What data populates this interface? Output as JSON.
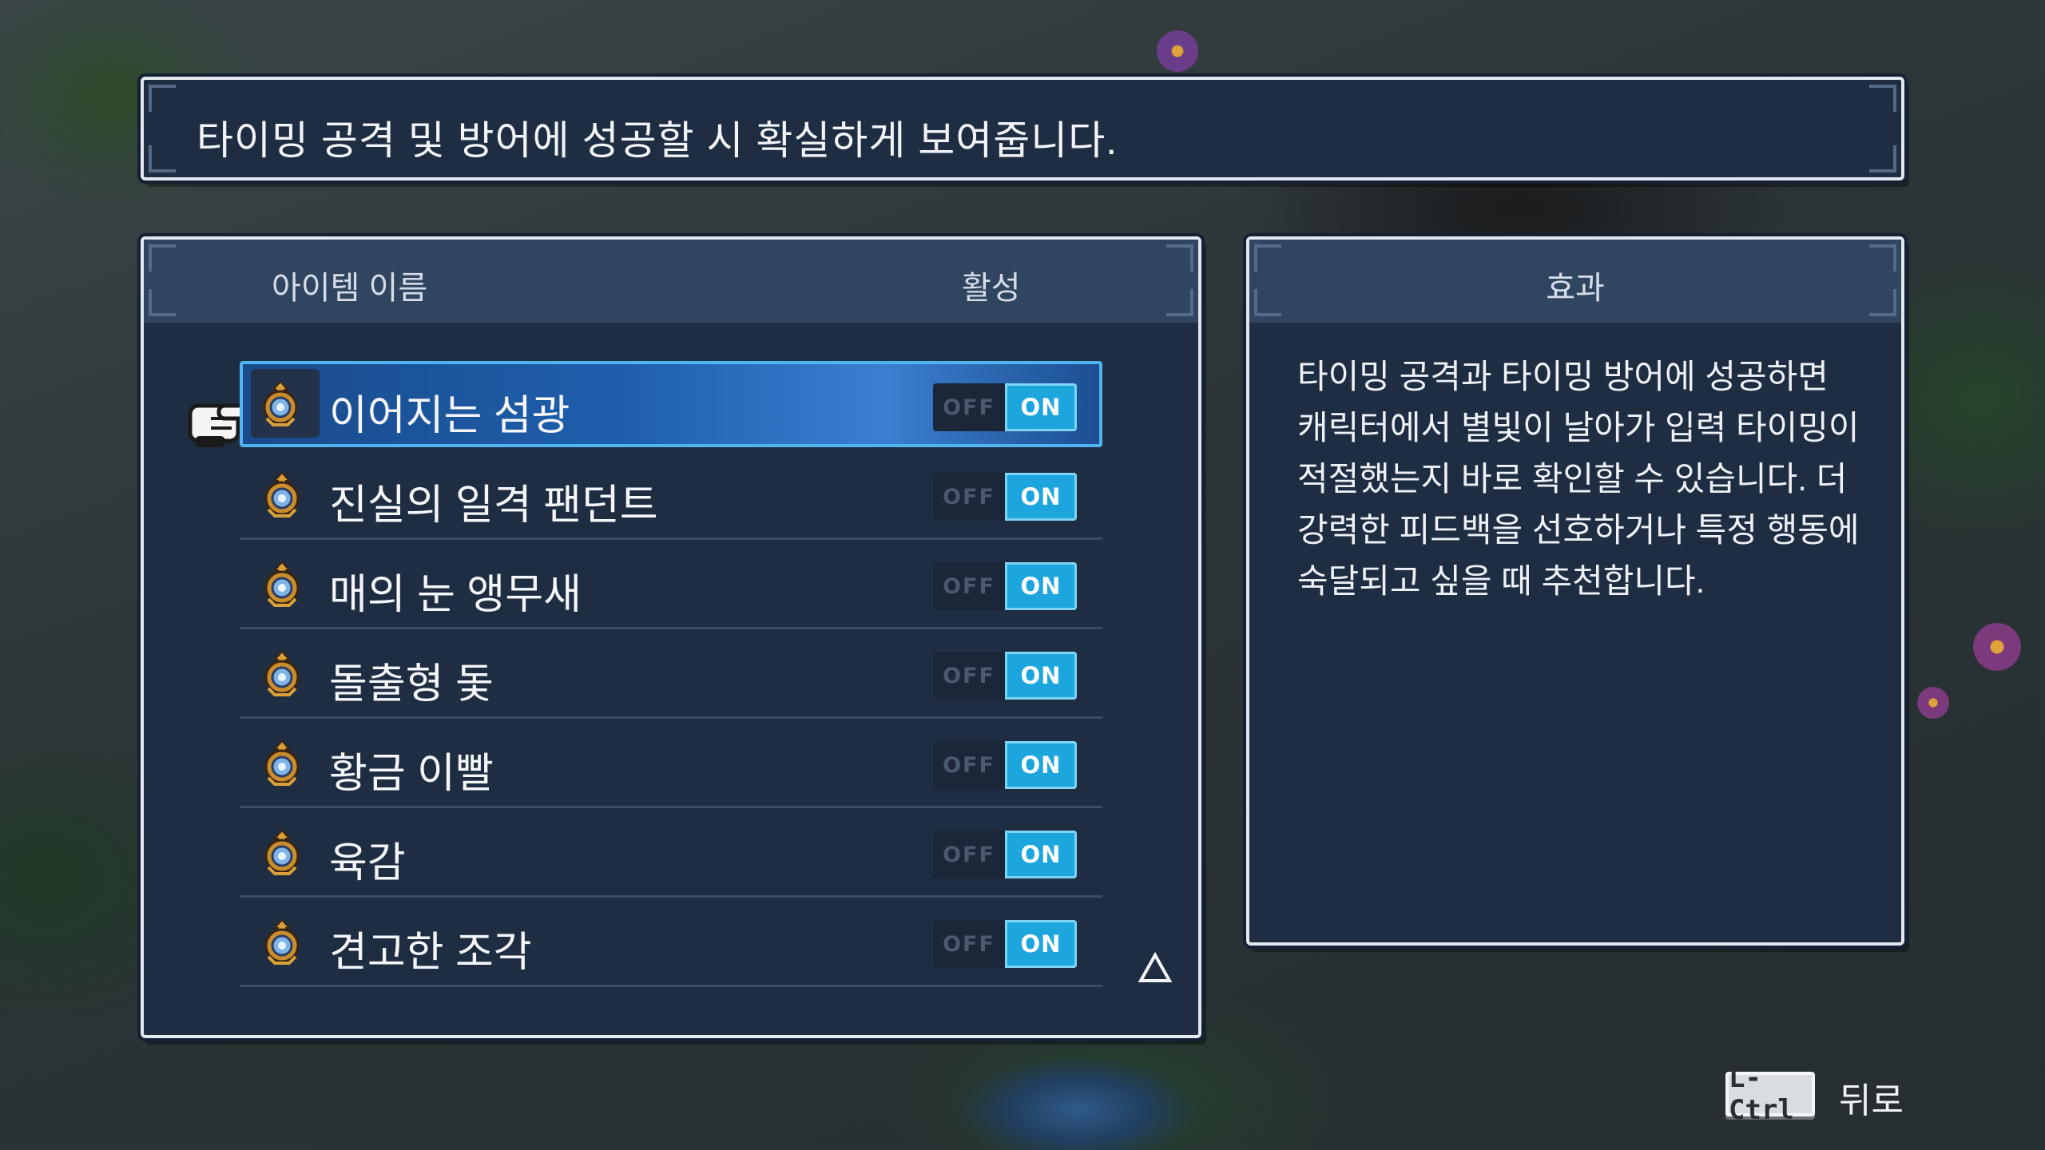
{
  "description": "타이밍 공격 및 방어에 성공할 시 확실하게 보여줍니다.",
  "list": {
    "header_name": "아이템 이름",
    "header_active": "활성",
    "items": [
      {
        "name": "이어지는 섬광",
        "off": "OFF",
        "on": "ON",
        "state": "on",
        "selected": true
      },
      {
        "name": "진실의 일격 팬던트",
        "off": "OFF",
        "on": "ON",
        "state": "on"
      },
      {
        "name": "매의 눈 앵무새",
        "off": "OFF",
        "on": "ON",
        "state": "on"
      },
      {
        "name": "돌출형 돛",
        "off": "OFF",
        "on": "ON",
        "state": "on"
      },
      {
        "name": "황금 이빨",
        "off": "OFF",
        "on": "ON",
        "state": "on"
      },
      {
        "name": "육감",
        "off": "OFF",
        "on": "ON",
        "state": "on"
      },
      {
        "name": "견고한 조각",
        "off": "OFF",
        "on": "ON",
        "state": "on"
      }
    ]
  },
  "effect": {
    "title": "효과",
    "text": "타이밍 공격과 타이밍 방어에 성공하면 캐릭터에서 별빛이 날아가 입력 타이밍이 적절했는지 바로 확인할 수 있습니다. 더 강력한 피드백을 선호하거나 특정 행동에 숙달되고 싶을 때 추천합니다."
  },
  "footer": {
    "key_label": "L-Ctrl",
    "back_label": "뒤로"
  },
  "icons": {
    "item": "item-medallion-icon",
    "pointer": "hand-pointer-icon",
    "scroll": "scroll-up-arrow-icon"
  },
  "colors": {
    "panel_bg": "#1f2d42",
    "header_bg": "#304660",
    "selected_bg": "#1f5fae",
    "toggle_on": "#1da6dd"
  }
}
